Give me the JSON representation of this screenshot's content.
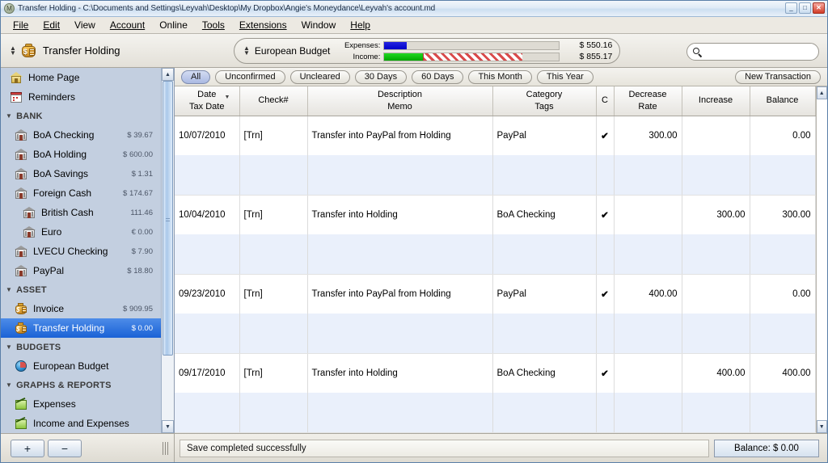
{
  "window": {
    "title": "Transfer Holding - C:\\Documents and Settings\\Leyvah\\Desktop\\My Dropbox\\Angie's Moneydance\\Leyvah's account.md",
    "app_icon": "moneydance-icon",
    "minimize_label": "_",
    "maximize_label": "□",
    "close_label": "✕"
  },
  "menubar": {
    "items": [
      {
        "label": "File",
        "mnemonic": "F"
      },
      {
        "label": "Edit",
        "mnemonic": "E"
      },
      {
        "label": "View",
        "mnemonic": "V"
      },
      {
        "label": "Account",
        "mnemonic": "A"
      },
      {
        "label": "Online",
        "mnemonic": "O"
      },
      {
        "label": "Tools",
        "mnemonic": "T"
      },
      {
        "label": "Extensions",
        "mnemonic": "E"
      },
      {
        "label": "Window",
        "mnemonic": "W"
      },
      {
        "label": "Help",
        "mnemonic": "H"
      }
    ]
  },
  "toolbar": {
    "account_name": "Transfer Holding",
    "account_icon": "money-bag-icon",
    "budget_name": "European Budget",
    "budget_selector_icon": "up-down-arrows-icon",
    "expenses_label": "Expenses:",
    "expenses_amount": "$ 550.16",
    "income_label": "Income:",
    "income_amount": "$ 855.17",
    "expenses_bar_pct": 13,
    "income_bar_green_pct": 22,
    "income_bar_hatch_pct": 57,
    "search_placeholder": "",
    "search_value": "",
    "search_icon": "search-icon",
    "colors": {
      "expenses_bar": "#0000c8",
      "income_bar": "#00a800",
      "income_over": "#d94a4a"
    }
  },
  "sidebar": {
    "items": [
      {
        "label": "Home Page",
        "amount": "",
        "icon": "home-icon",
        "type": "item",
        "indent": 0,
        "selected": false
      },
      {
        "label": "Reminders",
        "amount": "",
        "icon": "calendar-icon",
        "type": "item",
        "indent": 0,
        "selected": false
      },
      {
        "label": "BANK",
        "amount": "",
        "icon": "triangle-down-icon",
        "type": "group",
        "indent": 0,
        "selected": false
      },
      {
        "label": "BoA Checking",
        "amount": "$ 39.67",
        "icon": "bank-icon",
        "type": "item",
        "indent": 1,
        "selected": false
      },
      {
        "label": "BoA Holding",
        "amount": "$ 600.00",
        "icon": "bank-icon",
        "type": "item",
        "indent": 1,
        "selected": false
      },
      {
        "label": "BoA Savings",
        "amount": "$ 1.31",
        "icon": "bank-icon",
        "type": "item",
        "indent": 1,
        "selected": false
      },
      {
        "label": "Foreign Cash",
        "amount": "$ 174.67",
        "icon": "bank-icon",
        "type": "item",
        "indent": 1,
        "selected": false
      },
      {
        "label": "British Cash",
        "amount": "111.46",
        "icon": "bank-icon",
        "type": "item",
        "indent": 2,
        "selected": false
      },
      {
        "label": "Euro",
        "amount": "€ 0.00",
        "icon": "bank-icon",
        "type": "item",
        "indent": 2,
        "selected": false
      },
      {
        "label": "LVECU Checking",
        "amount": "$ 7.90",
        "icon": "bank-icon",
        "type": "item",
        "indent": 1,
        "selected": false
      },
      {
        "label": "PayPal",
        "amount": "$ 18.80",
        "icon": "bank-icon",
        "type": "item",
        "indent": 1,
        "selected": false
      },
      {
        "label": "ASSET",
        "amount": "",
        "icon": "triangle-down-icon",
        "type": "group",
        "indent": 0,
        "selected": false
      },
      {
        "label": "Invoice",
        "amount": "$ 909.95",
        "icon": "money-bag-icon",
        "type": "item",
        "indent": 1,
        "selected": false
      },
      {
        "label": "Transfer Holding",
        "amount": "$ 0.00",
        "icon": "money-bag-icon",
        "type": "item",
        "indent": 1,
        "selected": true
      },
      {
        "label": "BUDGETS",
        "amount": "",
        "icon": "triangle-down-icon",
        "type": "group",
        "indent": 0,
        "selected": false
      },
      {
        "label": "European Budget",
        "amount": "",
        "icon": "globe-icon",
        "type": "item",
        "indent": 1,
        "selected": false
      },
      {
        "label": "GRAPHS & REPORTS",
        "amount": "",
        "icon": "triangle-down-icon",
        "type": "group",
        "indent": 0,
        "selected": false
      },
      {
        "label": "Expenses",
        "amount": "",
        "icon": "graph-icon",
        "type": "item",
        "indent": 1,
        "selected": false
      },
      {
        "label": "Income and Expenses",
        "amount": "",
        "icon": "graph-icon",
        "type": "item",
        "indent": 1,
        "selected": false
      }
    ],
    "selection_color": "#1a62d6"
  },
  "filters": {
    "buttons": [
      {
        "label": "All",
        "active": true
      },
      {
        "label": "Unconfirmed",
        "active": false
      },
      {
        "label": "Uncleared",
        "active": false
      },
      {
        "label": "30 Days",
        "active": false
      },
      {
        "label": "60 Days",
        "active": false
      },
      {
        "label": "This Month",
        "active": false
      },
      {
        "label": "This Year",
        "active": false
      }
    ],
    "new_transaction_label": "New Transaction"
  },
  "register": {
    "columns": [
      {
        "line1": "Date",
        "line2": "Tax Date",
        "sorted": true,
        "sort_caret": "▼"
      },
      {
        "line1": "Check#",
        "line2": "",
        "sorted": false,
        "sort_caret": ""
      },
      {
        "line1": "Description",
        "line2": "Memo",
        "sorted": false,
        "sort_caret": ""
      },
      {
        "line1": "Category",
        "line2": "Tags",
        "sorted": false,
        "sort_caret": ""
      },
      {
        "line1": "C",
        "line2": "",
        "sorted": false,
        "sort_caret": ""
      },
      {
        "line1": "Decrease",
        "line2": "Rate",
        "sorted": false,
        "sort_caret": ""
      },
      {
        "line1": "Increase",
        "line2": "",
        "sorted": false,
        "sort_caret": ""
      },
      {
        "line1": "Balance",
        "line2": "",
        "sorted": false,
        "sort_caret": ""
      }
    ],
    "rows": [
      {
        "date": "10/07/2010",
        "check": "[Trn]",
        "description": "Transfer into PayPal from Holding",
        "category": "PayPal",
        "cleared": "✔",
        "decrease": "300.00",
        "increase": "",
        "balance": "0.00",
        "tax_date": "",
        "memo": "",
        "tags": ""
      },
      {
        "date": "10/04/2010",
        "check": "[Trn]",
        "description": "Transfer into Holding",
        "category": "BoA Checking",
        "cleared": "✔",
        "decrease": "",
        "increase": "300.00",
        "balance": "300.00",
        "tax_date": "",
        "memo": "",
        "tags": ""
      },
      {
        "date": "09/23/2010",
        "check": "[Trn]",
        "description": "Transfer into PayPal from Holding",
        "category": "PayPal",
        "cleared": "✔",
        "decrease": "400.00",
        "increase": "",
        "balance": "0.00",
        "tax_date": "",
        "memo": "",
        "tags": ""
      },
      {
        "date": "09/17/2010",
        "check": "[Trn]",
        "description": "Transfer into Holding",
        "category": "BoA Checking",
        "cleared": "✔",
        "decrease": "",
        "increase": "400.00",
        "balance": "400.00",
        "tax_date": "",
        "memo": "",
        "tags": ""
      }
    ]
  },
  "statusbar": {
    "add_label": "+",
    "remove_label": "−",
    "message": "Save completed successfully",
    "balance_label": "Balance: $ 0.00"
  }
}
